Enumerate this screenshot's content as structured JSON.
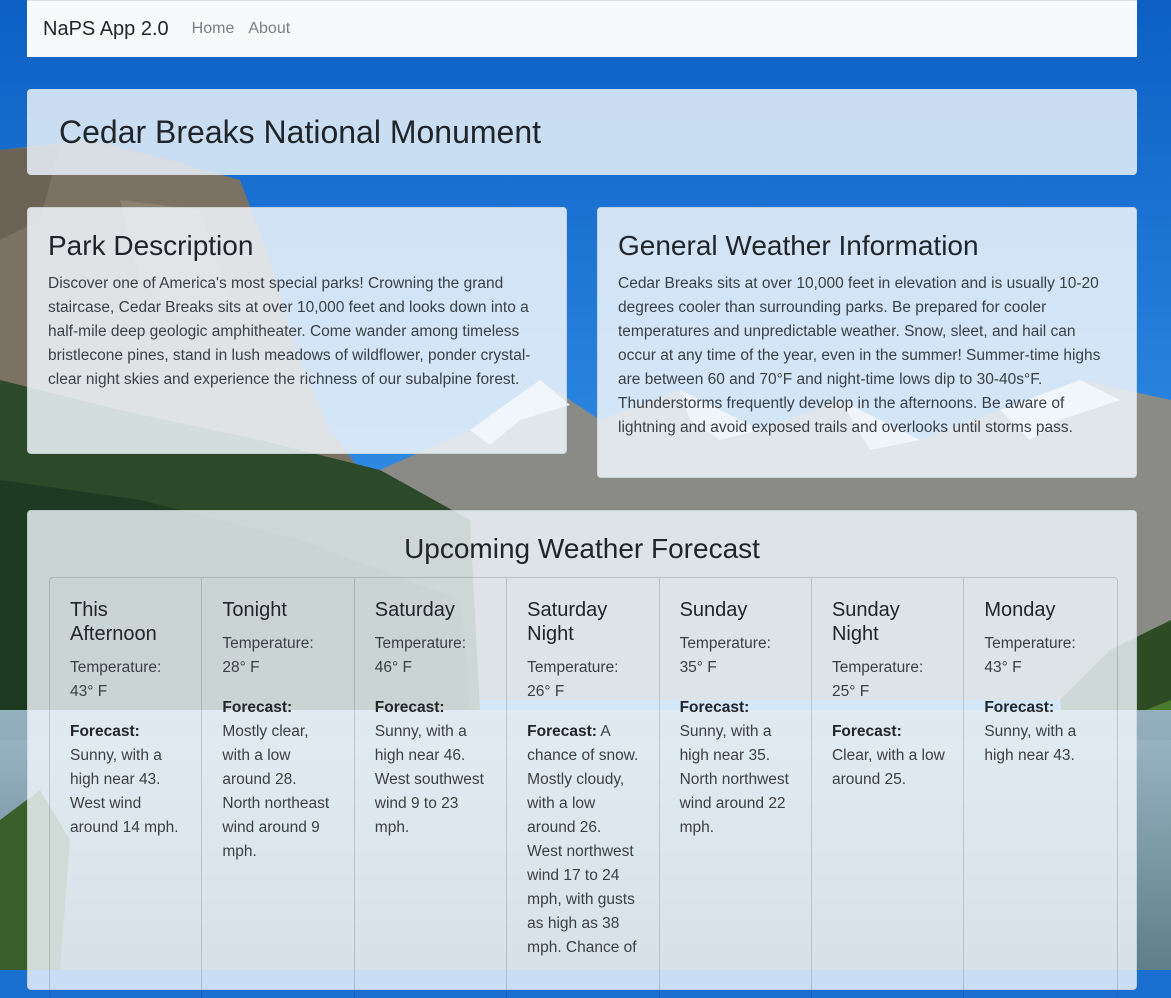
{
  "navbar": {
    "brand": "NaPS App 2.0",
    "links": [
      {
        "label": "Home"
      },
      {
        "label": "About"
      }
    ]
  },
  "park": {
    "name": "Cedar Breaks National Monument"
  },
  "description": {
    "title": "Park Description",
    "text": "Discover one of America's most special parks! Crowning the grand staircase, Cedar Breaks sits at over 10,000 feet and looks down into a half-mile deep geologic amphitheater. Come wander among timeless bristlecone pines, stand in lush meadows of wildflower, ponder crystal-clear night skies and experience the richness of our subalpine forest."
  },
  "weather_info": {
    "title": "General Weather Information",
    "text": "Cedar Breaks sits at over 10,000 feet in elevation and is usually 10-20 degrees cooler than surrounding parks. Be prepared for cooler temperatures and unpredictable weather. Snow, sleet, and hail can occur at any time of the year, even in the summer! Summer-time highs are between 60 and 70°F and night-time lows dip to 30-40s°F. Thunderstorms frequently develop in the afternoons. Be aware of lightning and avoid exposed trails and overlooks until storms pass."
  },
  "forecast": {
    "title": "Upcoming Weather Forecast",
    "temp_label": "Temperature:",
    "forecast_label": "Forecast:",
    "periods": [
      {
        "name": "This Afternoon",
        "temperature": "43° F",
        "text": "Sunny, with a high near 43. West wind around 14 mph."
      },
      {
        "name": "Tonight",
        "temperature": "28° F",
        "text": "Mostly clear, with a low around 28. North northeast wind around 9 mph."
      },
      {
        "name": "Saturday",
        "temperature": "46° F",
        "text": "Sunny, with a high near 46. West southwest wind 9 to 23 mph."
      },
      {
        "name": "Saturday Night",
        "temperature": "26° F",
        "text": "A chance of snow. Mostly cloudy, with a low around 26. West northwest wind 17 to 24 mph, with gusts as high as 38 mph. Chance of"
      },
      {
        "name": "Sunday",
        "temperature": "35° F",
        "text": "Sunny, with a high near 35. North northwest wind around 22 mph."
      },
      {
        "name": "Sunday Night",
        "temperature": "25° F",
        "text": "Clear, with a low around 25."
      },
      {
        "name": "Monday",
        "temperature": "43° F",
        "text": "Sunny, with a high near 43."
      }
    ]
  }
}
